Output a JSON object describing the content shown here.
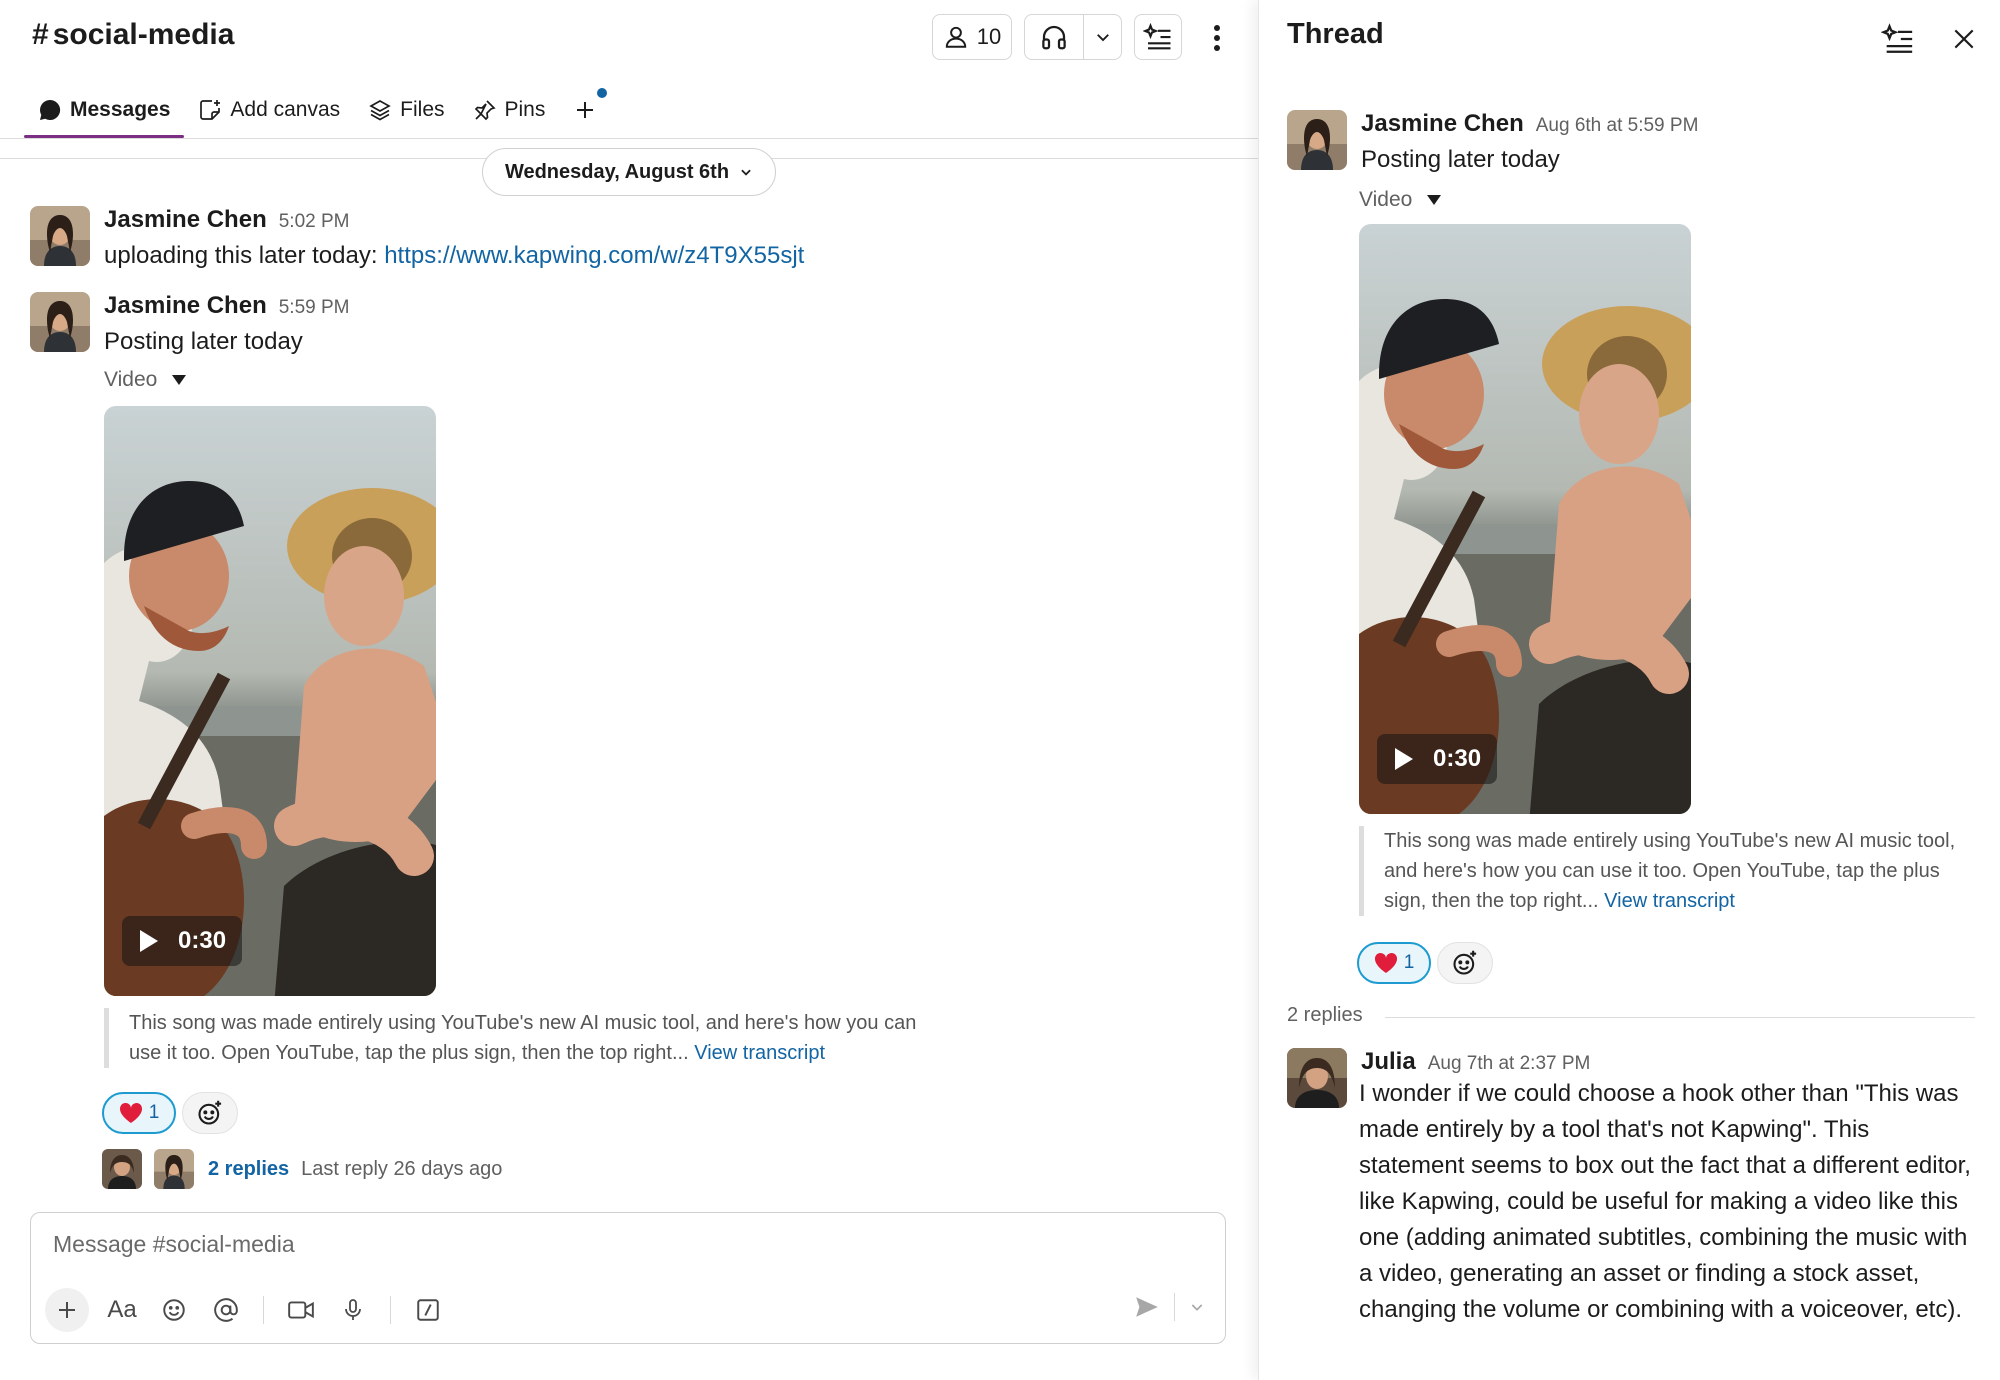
{
  "channel": {
    "name": "social-media",
    "hash": "#",
    "members_count": "10",
    "tabs": [
      {
        "label": "Messages"
      },
      {
        "label": "Add canvas"
      },
      {
        "label": "Files"
      },
      {
        "label": "Pins"
      }
    ],
    "date_divider": "Wednesday, August 6th",
    "messages": [
      {
        "author": "Jasmine Chen",
        "time": "5:02 PM",
        "text": "uploading this later today: ",
        "link": "https://www.kapwing.com/w/z4T9X55sjt"
      },
      {
        "author": "Jasmine Chen",
        "time": "5:59 PM",
        "text": "Posting later today",
        "attachment_label": "Video",
        "video_duration": "0:30",
        "quote": "This song was made entirely using YouTube's new AI music tool, and here's how you can use it too. Open YouTube, tap the plus sign, then the top right...",
        "quote_link": "View transcript",
        "reaction_count": "1",
        "replies_label": "2 replies",
        "replies_meta": "Last reply 26 days ago"
      }
    ],
    "composer_placeholder": "Message #social-media",
    "composer_format_label": "Aa"
  },
  "thread": {
    "title": "Thread",
    "parent": {
      "author": "Jasmine Chen",
      "time": "Aug 6th at 5:59 PM",
      "text": "Posting later today",
      "attachment_label": "Video",
      "video_duration": "0:30",
      "quote": "This song was made entirely using YouTube's new AI music tool, and here's how you can use it too. Open YouTube, tap the plus sign, then the top right...",
      "quote_link": "View transcript",
      "reaction_count": "1"
    },
    "replies_count_label": "2 replies",
    "reply": {
      "author": "Julia",
      "time": "Aug 7th at 2:37 PM",
      "text": "I wonder if we could choose a hook other than \"This was made entirely by a tool that's not Kapwing\". This statement seems to box out the fact that a different editor, like Kapwing, could be useful for making a video like this one (adding animated subtitles, combining the music with a video, generating an asset or finding a stock asset, changing the volume or combining with a voiceover, etc)."
    }
  },
  "colors": {
    "accent_tab": "#7c2e84",
    "link": "#1264a3",
    "reaction_border": "#1d9bd1"
  }
}
